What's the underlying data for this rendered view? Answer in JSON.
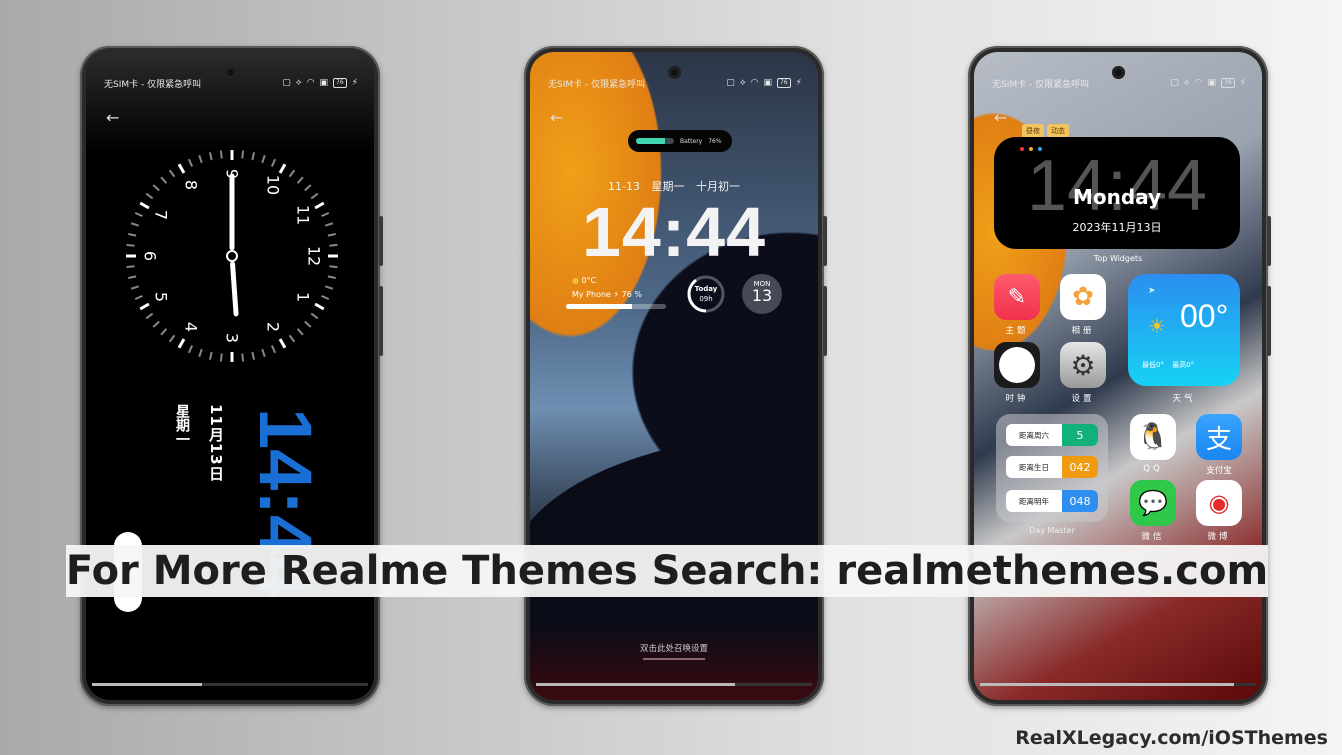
{
  "status_bar": {
    "carrier": "无SIM卡 - 仅限紧急呼叫",
    "battery": "76",
    "icons": [
      "nfc-icon",
      "vibrate-icon",
      "wifi-icon",
      "screenshot-icon",
      "battery-icon",
      "charging-icon"
    ]
  },
  "back_icon": "←",
  "phone1": {
    "clock_numbers": [
      "12",
      "1",
      "2",
      "3",
      "4",
      "5",
      "6",
      "7",
      "8",
      "9",
      "10",
      "11"
    ],
    "date": "11月13日",
    "weekday": "星期一",
    "time": "14:44"
  },
  "phone2": {
    "battery_widget": {
      "label": "Battery",
      "percent": "76%",
      "level": 0.76
    },
    "date_line": "11-13 星期一 十月初一",
    "time": "14:44",
    "weather": "0°C",
    "device": {
      "name": "My Phone ⚡",
      "percent": "76 %",
      "level": 0.66
    },
    "today": {
      "label": "Today",
      "hours": "09h",
      "progress": 0.4
    },
    "calendar": {
      "day": "MON",
      "date": "13"
    },
    "hint": "双击此处召唤设置"
  },
  "phone3": {
    "tags": [
      "昼夜",
      "动态"
    ],
    "widget": {
      "time": "14:44",
      "day": "Monday",
      "date": "2023年11月13日",
      "caption": "Top Widgets",
      "dot_colors": [
        "#ef3b3b",
        "#f5a623",
        "#29a9f0"
      ]
    },
    "apps": [
      {
        "label": "主题",
        "icon": "theme-icon"
      },
      {
        "label": "相册",
        "icon": "photos-icon"
      },
      {
        "label": "时钟",
        "icon": "clock-icon"
      },
      {
        "label": "设置",
        "icon": "settings-icon"
      },
      {
        "label": "QQ",
        "icon": "qq-icon"
      },
      {
        "label": "支付宝",
        "icon": "alipay-icon"
      },
      {
        "label": "微信",
        "icon": "wechat-icon"
      },
      {
        "label": "微博",
        "icon": "weibo-icon"
      }
    ],
    "weather_widget": {
      "temp": "00°",
      "low": "最低0°",
      "high": "最高0°",
      "caption": "天气"
    },
    "day_master": {
      "caption": "Day Master",
      "rows": [
        {
          "label": "距离周六",
          "value": "5",
          "color": "#12b07a"
        },
        {
          "label": "距离生日",
          "value": "042",
          "color": "#f09a12"
        },
        {
          "label": "距离明年",
          "value": "048",
          "color": "#2f8ff0"
        }
      ]
    }
  },
  "banner": "For More Realme Themes Search: realmethemes.com",
  "footer": "RealXLegacy.com/iOSThemes"
}
